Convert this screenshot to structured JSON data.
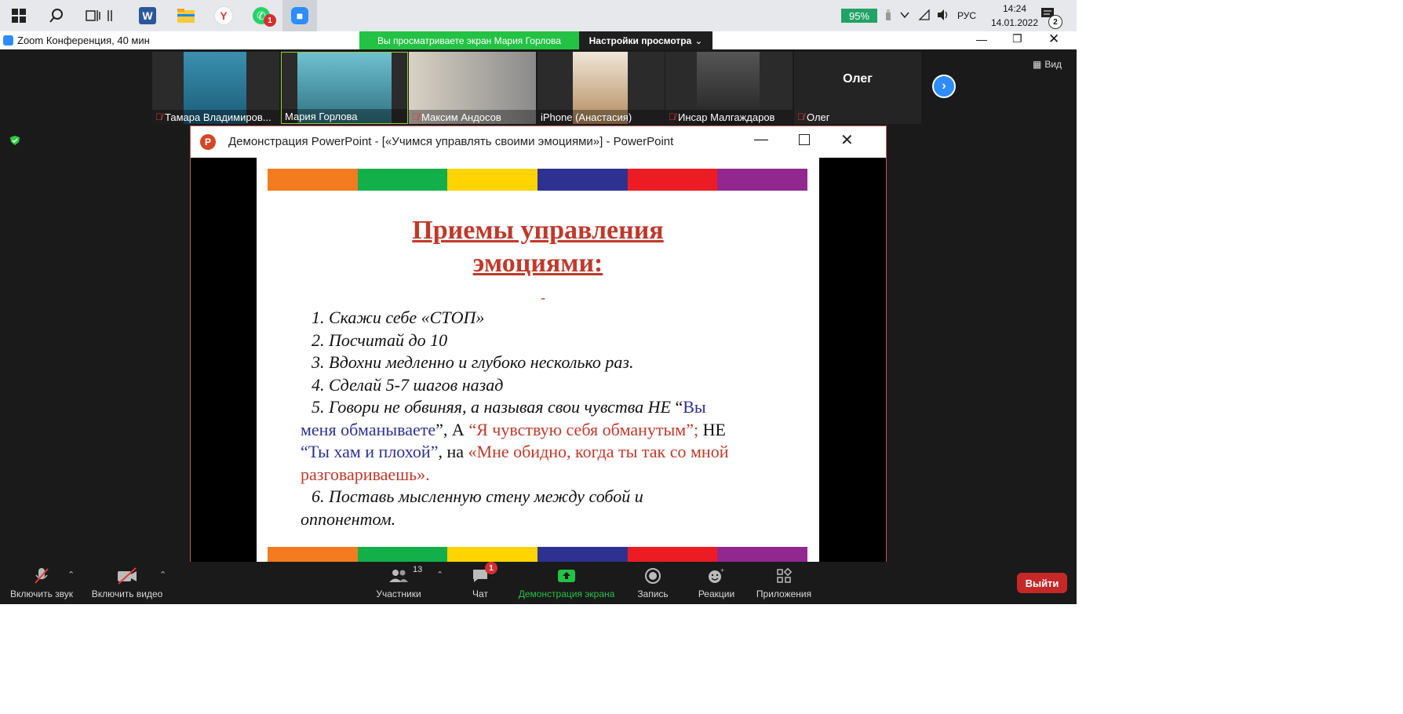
{
  "taskbar": {
    "icons": [
      "windows-icon",
      "search-icon",
      "task-view-icon",
      "divider",
      "word-icon",
      "file-explorer-icon",
      "yandex-icon",
      "whatsapp-icon",
      "zoom-icon"
    ],
    "whatsapp_badge": "1",
    "battery": "95%",
    "language": "РУС",
    "time": "14:24",
    "date": "14.01.2022",
    "notif_count": "2"
  },
  "zoom": {
    "window_title": "Zoom Конференция, 40 мин",
    "share_banner": "Вы просматриваете экран Мария Горлова",
    "view_settings": "Настройки просмотра",
    "view_label": "Вид",
    "participants": [
      {
        "name": "Тамара Владимиров...",
        "muted": true
      },
      {
        "name": "Мария Горлова",
        "muted": false
      },
      {
        "name": "Максим Андосов",
        "muted": true
      },
      {
        "name": "iPhone (Анастасия)",
        "muted": false
      },
      {
        "name": "Инсар Малгаждаров",
        "muted": true
      },
      {
        "name": "Олег",
        "muted": true
      }
    ],
    "oleg_big_name": "Олег"
  },
  "ppt": {
    "window_title": "Демонстрация PowerPoint - [«Учимся управлять своими эмоциями»] - PowerPoint",
    "slide": {
      "title_line1": "Приемы управления",
      "title_line2": "эмоциями:",
      "dash": "-",
      "items": [
        "1. Скажи себе «СТОП»",
        "2. Посчитай до 10",
        "3. Вдохни медленно и глубоко несколько раз.",
        "4.  Сделай 5-7 шагов назад"
      ],
      "item5_prefix": "5.  Говори не обвиняя, а называя свои чувства НЕ",
      "item5_quote_open": " “",
      "item5_blue1a": "Вы",
      "item5_blue1b": "меня обманываете",
      "item5_mid1": "”, А ",
      "item5_red1": "“Я чувствую себя обманутым”;",
      "item5_mid2": "  НЕ",
      "item5_blue2": "“Ты хам и плохой”",
      "item5_mid3": ", на ",
      "item5_red2a": "«Мне обидно, когда ты так со мной",
      "item5_red2b": "разговариваешь».",
      "item6a": "6. Поставь мысленную стену между собой и",
      "item6b": "оппонентом."
    },
    "stripe_colors": [
      "#f47b20",
      "#13b04a",
      "#ffd400",
      "#2e3192",
      "#ed1c24",
      "#92278f"
    ]
  },
  "toolbar": {
    "mute_label": "Включить звук",
    "video_label": "Включить видео",
    "participants_label": "Участники",
    "participants_count": "13",
    "chat_label": "Чат",
    "chat_badge": "1",
    "share_label": "Демонстрация экрана",
    "record_label": "Запись",
    "reactions_label": "Реакции",
    "apps_label": "Приложения",
    "leave_label": "Выйти"
  }
}
